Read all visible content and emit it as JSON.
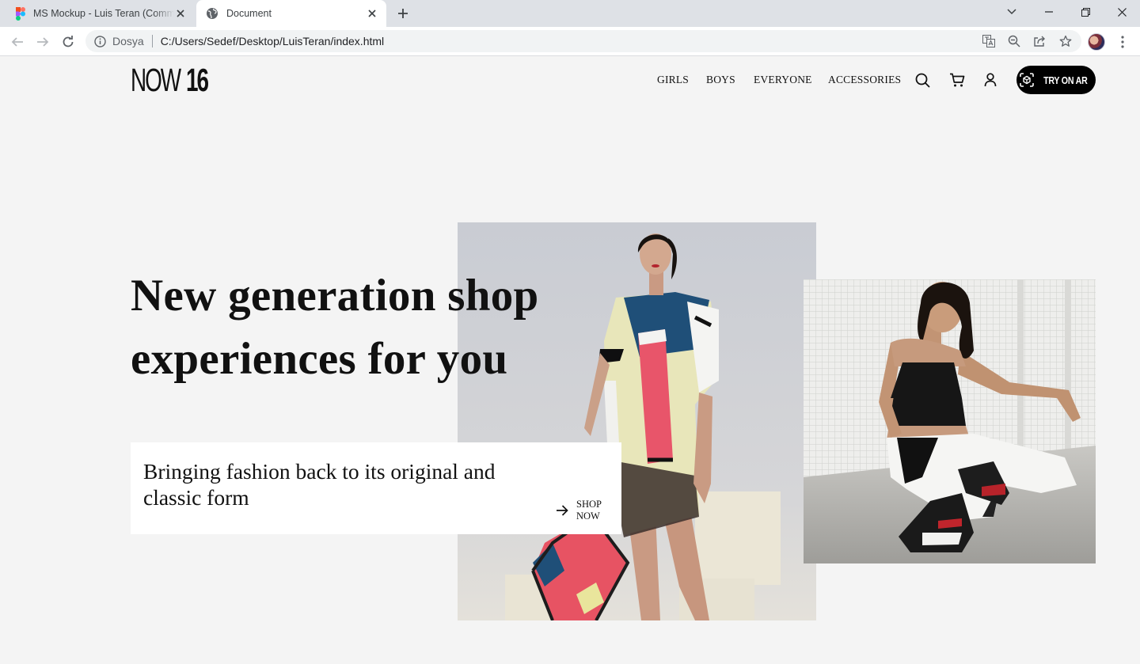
{
  "browser": {
    "tabs": [
      {
        "title": "MS Mockup - Luis Teran (Community)",
        "icon": "figma-icon",
        "active": false
      },
      {
        "title": "Document",
        "icon": "globe-icon",
        "active": true
      }
    ],
    "address": {
      "site_label": "Dosya",
      "url": "C:/Users/Sedef/Desktop/LuisTeran/index.html"
    }
  },
  "site": {
    "logo": {
      "part1": "NOW",
      "part2": "16"
    },
    "nav": [
      {
        "label": "GIRLS"
      },
      {
        "label": "BOYS"
      },
      {
        "label": "EVERYONE"
      },
      {
        "label": "ACCESSORIES"
      }
    ],
    "icons": [
      "search-icon",
      "cart-icon",
      "user-icon"
    ],
    "cta": {
      "label": "TRY ON AR",
      "icon": "ar-scan-icon"
    }
  },
  "hero": {
    "title_line1": "New generation shop",
    "title_line2": "experiences for you",
    "card_text": "Bringing fashion back to its original and classic form",
    "shop_now_line1": "SHOP",
    "shop_now_line2": "NOW"
  },
  "colors": {
    "page_bg": "#f4f4f4",
    "text": "#111111",
    "cta_bg": "#000000",
    "card_bg": "#ffffff",
    "tabstrip_bg": "#dee1e6"
  }
}
